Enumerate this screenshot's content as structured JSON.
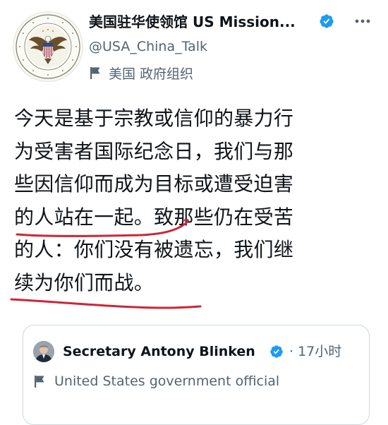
{
  "account": {
    "display_name": "美国驻华使领馆 US Mission...",
    "handle": "@USA_China_Talk",
    "label": "美国 政府组织",
    "verified": true
  },
  "tweet": {
    "lines": [
      "今天是基于宗教或信仰的暴力行",
      "为受害者国际纪念日，我们与那",
      "些因信仰而成为目标或遭受迫害",
      "的人站在一起。致那些仍在受苦",
      "的人：你们没有被遗忘，我们继",
      "续为你们而战。"
    ]
  },
  "quoted": {
    "display_name": "Secretary Antony Blinken",
    "time": "· 17小时",
    "label": "United States government official",
    "verified": true
  },
  "colors": {
    "verified_blue": "#1d9bf0",
    "secondary_text": "#536471",
    "annotation_red": "#c8283a"
  }
}
